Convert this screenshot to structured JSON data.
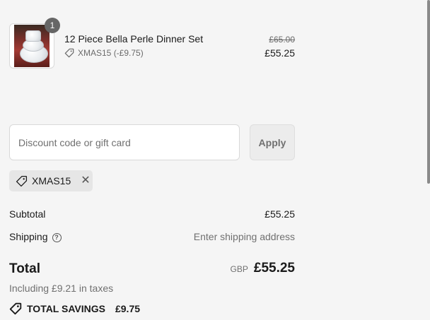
{
  "product": {
    "title": "12 Piece Bella Perle Dinner Set",
    "quantity": "1",
    "discount": "XMAS15 (-£9.75)",
    "original_price": "£65.00",
    "price": "£55.25"
  },
  "discount": {
    "placeholder": "Discount code or gift card",
    "apply_label": "Apply",
    "applied_code": "XMAS15",
    "remove_symbol": "✕"
  },
  "totals": {
    "subtotal_label": "Subtotal",
    "subtotal_value": "£55.25",
    "shipping_label": "Shipping",
    "shipping_value": "Enter shipping address",
    "total_label": "Total",
    "currency": "GBP",
    "total_value": "£55.25",
    "taxes_note": "Including £9.21 in taxes",
    "savings_label": "TOTAL SAVINGS",
    "savings_value": "£9.75"
  },
  "icons": {
    "tag": "tag-icon",
    "help": "question-circle-icon",
    "close": "close-icon"
  }
}
